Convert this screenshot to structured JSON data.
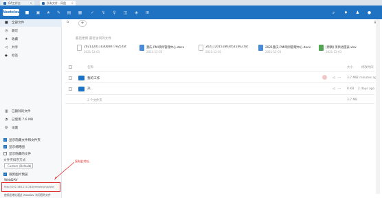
{
  "browser": {
    "tabs": [
      {
        "label": "OA工作台"
      },
      {
        "label": "所有文件 - 网盘"
      }
    ]
  },
  "header": {
    "logo": "Nextcloud",
    "app_icons": [
      "home-icon",
      "folder-icon",
      "image-icon",
      "star-icon",
      "pencil-icon",
      "contacts-icon",
      "calendar-icon",
      "check-icon",
      "chart-icon",
      "notes-icon",
      "grid-icon",
      "shield-icon"
    ],
    "right_icons": [
      "search-icon",
      "bell-icon",
      "contacts-icon",
      "avatar-icon"
    ]
  },
  "sidebar": {
    "items": [
      {
        "icon": "folder-icon",
        "label": "全部文件",
        "active": true
      },
      {
        "icon": "clock-icon",
        "label": "最近"
      },
      {
        "icon": "star-icon",
        "label": "收藏"
      },
      {
        "icon": "share-icon",
        "label": "共享"
      },
      {
        "icon": "tag-icon",
        "label": "标签"
      }
    ],
    "bottom_items": [
      {
        "icon": "trash-icon",
        "label": "已删除的文件"
      },
      {
        "icon": "pie-icon",
        "label": "已使用 7.6 MB"
      },
      {
        "icon": "gear-icon",
        "label": "设置"
      }
    ],
    "settings": {
      "checkboxes": [
        {
          "label": "显示隐藏文件和文件夹",
          "checked": true
        },
        {
          "label": "显示缩略图",
          "checked": true
        },
        {
          "label": "显示隐藏的文件",
          "checked": false
        }
      ],
      "sort_label": "文件夹排序方式",
      "sort_value": "Custom (Default)",
      "crop_label": "裁剪图片预览",
      "webdav_label": "WebDAV",
      "webdav_url": "http://192.168.110.248/remote.php/dav/",
      "webdav_hint": "使用此地址通过 WebDAV 访问您的文件"
    }
  },
  "annotation": {
    "text": "复制此地址"
  },
  "main": {
    "recent_title": "最近更新  最近访问的文件",
    "recent": [
      {
        "name": "20211201103000077925.txt",
        "date": "2021-12-01",
        "type": "txt"
      },
      {
        "name": "重庆-PMI项目管理中心.docx",
        "date": "2021-12-03",
        "type": "doc"
      },
      {
        "name": "20211201518030515462.txt",
        "date": "2021-12-01",
        "type": "txt"
      },
      {
        "name": "2021重庆-PMI项目管理中心.docx",
        "date": "2021-12-03",
        "type": "doc"
      },
      {
        "name": "[原稿] 项目进度表.xlsx",
        "date": "2021-12-03",
        "type": "xls"
      }
    ],
    "columns": {
      "name": "名称",
      "size": "大小",
      "modified": "修改时间"
    },
    "rows": [
      {
        "name": "我的工作",
        "size": "3.7 MB",
        "modified": "2 minutes ago",
        "shared": true
      },
      {
        "name": "ZL",
        "size": "0 KB",
        "modified": "2 days ago",
        "shared": false
      }
    ],
    "summary_left": "2 个文件夹",
    "summary_right": "3.7 MB"
  }
}
